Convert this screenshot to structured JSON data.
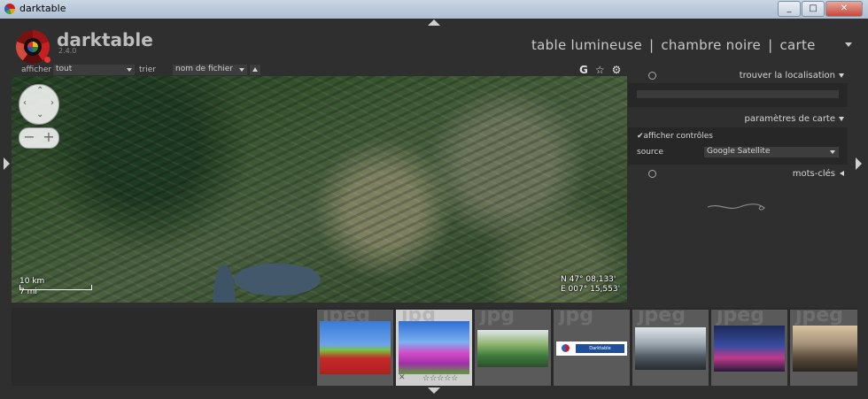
{
  "window": {
    "title": "darktable",
    "buttons": [
      "_",
      "□",
      "✕"
    ]
  },
  "app": {
    "name": "darktable",
    "version": "2.4.0"
  },
  "views": {
    "lighttable": "table lumineuse",
    "darkroom": "chambre noire",
    "map": "carte",
    "separator": "|"
  },
  "filter": {
    "show_label": "afficher",
    "show_value": "tout",
    "sort_label": "trier par",
    "sort_value": "nom de fichier"
  },
  "top_icons": {
    "grouping": "G",
    "star": "☆",
    "settings": "⚙"
  },
  "map": {
    "scale_km": "10 km",
    "scale_mi": "7 mi",
    "coord_n": "N 47° 08,133'",
    "coord_e": "E 007° 15,553'"
  },
  "panel": {
    "find_location": "trouver la localisation",
    "map_settings": "paramètres de carte",
    "show_controls": "afficher contrôles",
    "source_label": "source",
    "source_value": "Google Satellite",
    "keywords": "mots-clés"
  },
  "filmstrip": {
    "thumbnails": [
      {
        "ext": "jpeg",
        "selected": false
      },
      {
        "ext": "jpg",
        "selected": true,
        "reject": "✕",
        "stars": "☆☆☆☆☆"
      },
      {
        "ext": "jpg",
        "selected": false
      },
      {
        "ext": "jpg",
        "selected": false,
        "banner": "Darktable"
      },
      {
        "ext": "jpeg",
        "selected": false
      },
      {
        "ext": "jpeg",
        "selected": false
      },
      {
        "ext": "jpeg",
        "selected": false
      }
    ]
  }
}
